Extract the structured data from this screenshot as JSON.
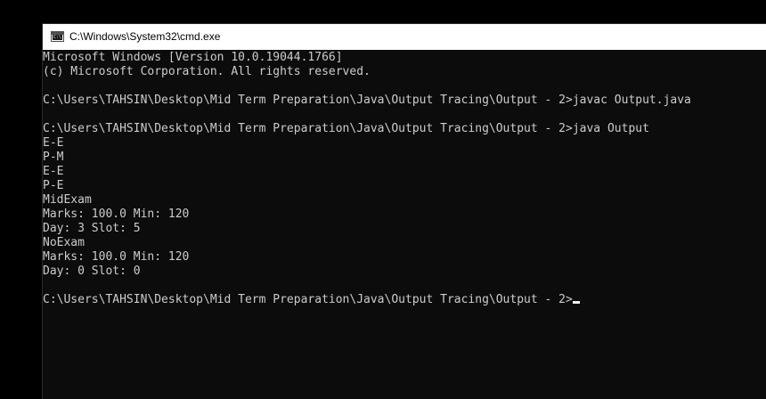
{
  "window": {
    "title": "C:\\Windows\\System32\\cmd.exe",
    "icon": "cmd-console-icon",
    "icon_glyph": "C:\\"
  },
  "console": {
    "lines": [
      "Microsoft Windows [Version 10.0.19044.1766]",
      "(c) Microsoft Corporation. All rights reserved.",
      "",
      "C:\\Users\\TAHSIN\\Desktop\\Mid Term Preparation\\Java\\Output Tracing\\Output - 2>javac Output.java",
      "",
      "C:\\Users\\TAHSIN\\Desktop\\Mid Term Preparation\\Java\\Output Tracing\\Output - 2>java Output",
      "E-E",
      "P-M",
      "E-E",
      "P-E",
      "MidExam",
      "Marks: 100.0 Min: 120",
      "Day: 3 Slot: 5",
      "NoExam",
      "Marks: 100.0 Min: 120",
      "Day: 0 Slot: 0",
      "",
      "C:\\Users\\TAHSIN\\Desktop\\Mid Term Preparation\\Java\\Output Tracing\\Output - 2>"
    ],
    "text_color": "#cccccc",
    "background_color": "#0c0c0c"
  }
}
